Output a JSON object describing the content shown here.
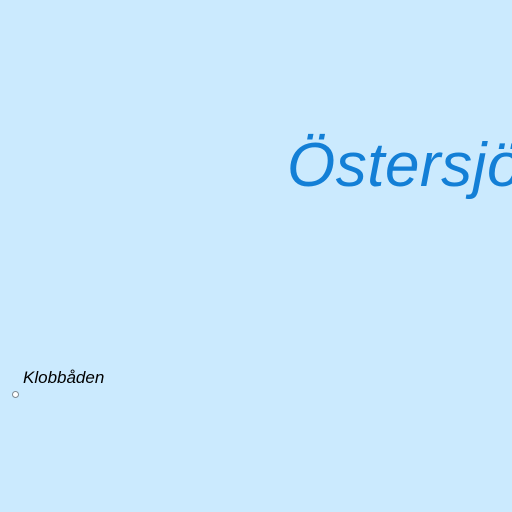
{
  "map": {
    "water_color": "#cbeafe",
    "water_label_color": "#137fd6",
    "sea_name": "Östersjön",
    "places": [
      {
        "name": "Klobbåden",
        "icon": "point-marker-icon"
      }
    ]
  }
}
